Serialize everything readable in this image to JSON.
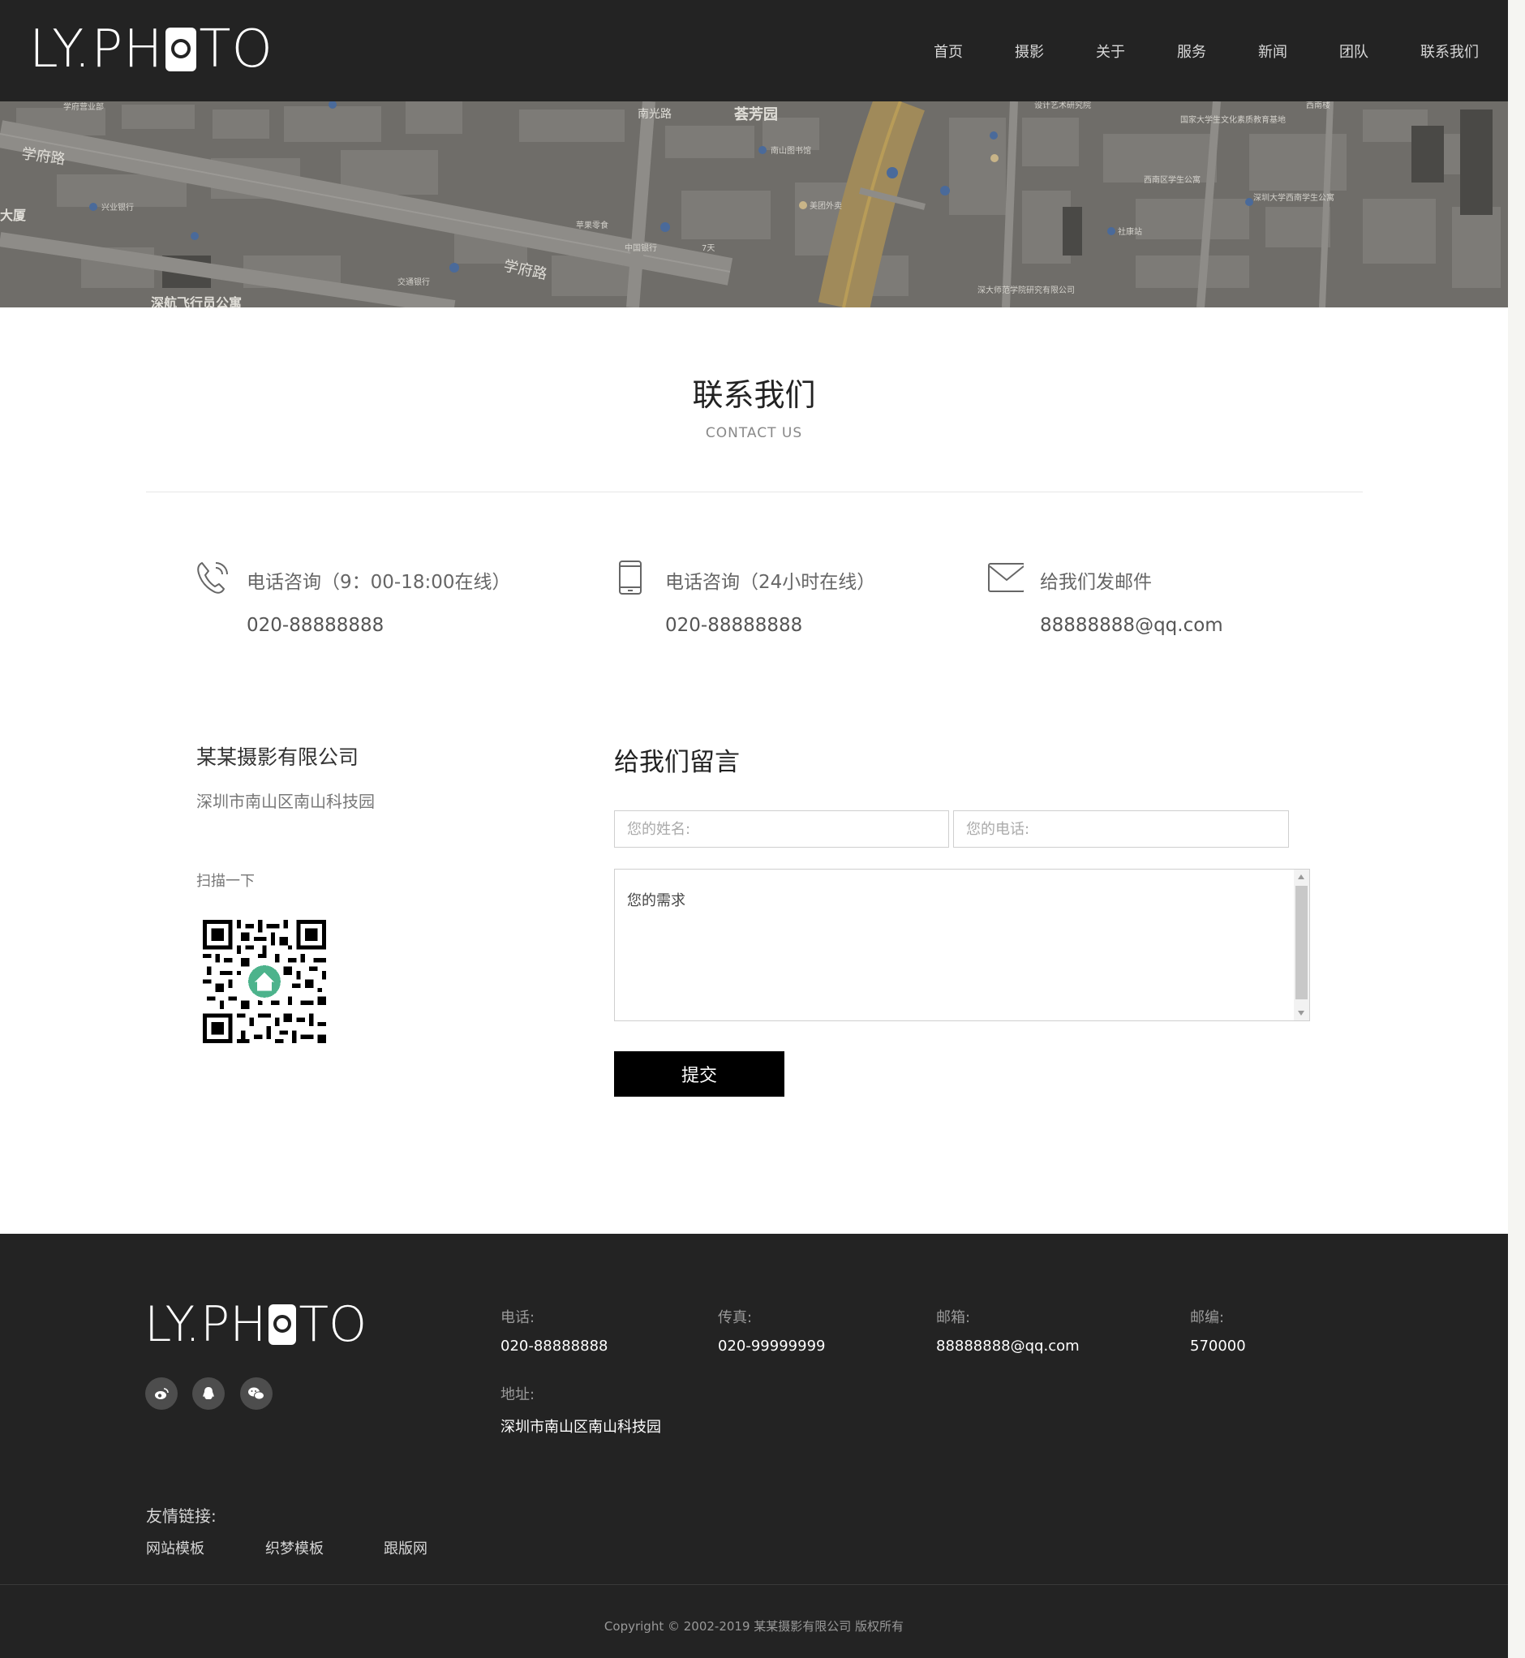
{
  "brand": {
    "logo_before": "LY.PH",
    "logo_after": "TO"
  },
  "nav": [
    {
      "label": "首页"
    },
    {
      "label": "摄影"
    },
    {
      "label": "关于"
    },
    {
      "label": "服务"
    },
    {
      "label": "新闻"
    },
    {
      "label": "团队"
    },
    {
      "label": "联系我们"
    }
  ],
  "map": {
    "labels": [
      "学府路",
      "学府路",
      "荟芳园",
      "南光路",
      "大厦",
      "深航飞行员公寓",
      "学府营业部",
      "兴业银行",
      "中国银行",
      "交通银行",
      "苹果零食",
      "南山图书馆",
      "国家大学生文化素质教育基地",
      "深圳大学西南学生公寓",
      "西南区学生公寓",
      "社康站",
      "深大师范学院研究有限公司",
      "美团外卖",
      "7天",
      "设计艺术研究院",
      "西南楼"
    ]
  },
  "heading": {
    "title": "联系我们",
    "subtitle": "CONTACT US"
  },
  "contact_cards": [
    {
      "icon": "phone-icon",
      "label": "电话咨询（9：00-18:00在线）",
      "value": "020-88888888"
    },
    {
      "icon": "mobile-icon",
      "label": "电话咨询（24小时在线）",
      "value": "020-88888888"
    },
    {
      "icon": "envelope-icon",
      "label": "给我们发邮件",
      "value": "88888888@qq.com"
    }
  ],
  "company": {
    "name": "某某摄影有限公司",
    "address": "深圳市南山区南山科技园",
    "scan_label": "扫描一下"
  },
  "form": {
    "title": "给我们留言",
    "name_placeholder": "您的姓名:",
    "phone_placeholder": "您的电话:",
    "message_placeholder": "您的需求",
    "submit_label": "提交"
  },
  "footer": {
    "logo_before": "LY.PH",
    "logo_after": "TO",
    "social": [
      "weibo-icon",
      "qq-icon",
      "wechat-icon"
    ],
    "phone_label": "电话:",
    "phone": "020-88888888",
    "fax_label": "传真:",
    "fax": "020-99999999",
    "email_label": "邮箱:",
    "email": "88888888@qq.com",
    "zip_label": "邮编:",
    "zip": "570000",
    "address_label": "地址:",
    "address": "深圳市南山区南山科技园",
    "links_title": "友情链接:",
    "links": [
      {
        "label": "网站模板"
      },
      {
        "label": "织梦模板"
      },
      {
        "label": "跟版网"
      }
    ],
    "copyright": "Copyright © 2002-2019 某某摄影有限公司 版权所有"
  },
  "colors": {
    "header_bg": "#232323",
    "footer_bg": "#232323",
    "button_bg": "#000000",
    "accent_qr": "#4db38c"
  }
}
